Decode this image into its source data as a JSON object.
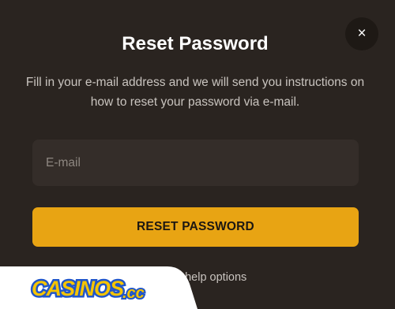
{
  "modal": {
    "title": "Reset Password",
    "description": "Fill in your e-mail address and we will send you instructions on how to reset your password via e-mail.",
    "close_icon_glyph": "×",
    "email_field": {
      "placeholder": "E-mail",
      "value": ""
    },
    "reset_button_label": "RESET PASSWORD",
    "help_link_label": "Back to help options"
  },
  "watermark": {
    "logo_text": "CASINOS.cc"
  },
  "colors": {
    "background": "#2a2420",
    "input_background": "#342d29",
    "accent": "#e8a413",
    "text_primary": "#ffffff",
    "text_secondary": "#c9c4bf"
  }
}
